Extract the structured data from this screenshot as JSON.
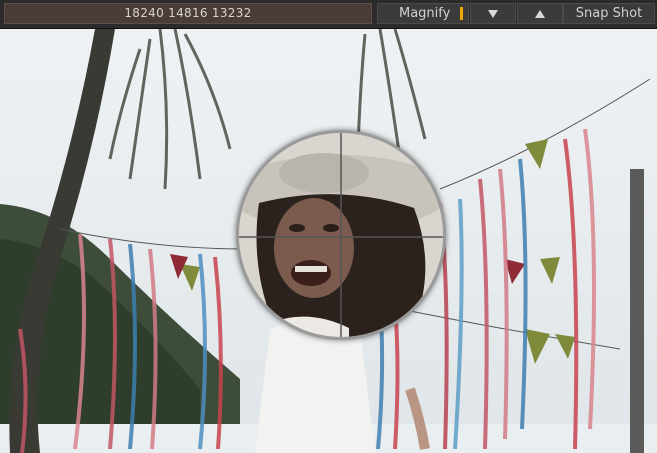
{
  "toolbar": {
    "readout": "18240  14816  13232",
    "magnify_label": "Magnify",
    "snap_label": "Snap Shot",
    "magnify_indicator_color": "#f0a500"
  },
  "icons": {
    "down": "triangle-down-icon",
    "up": "triangle-up-icon"
  }
}
